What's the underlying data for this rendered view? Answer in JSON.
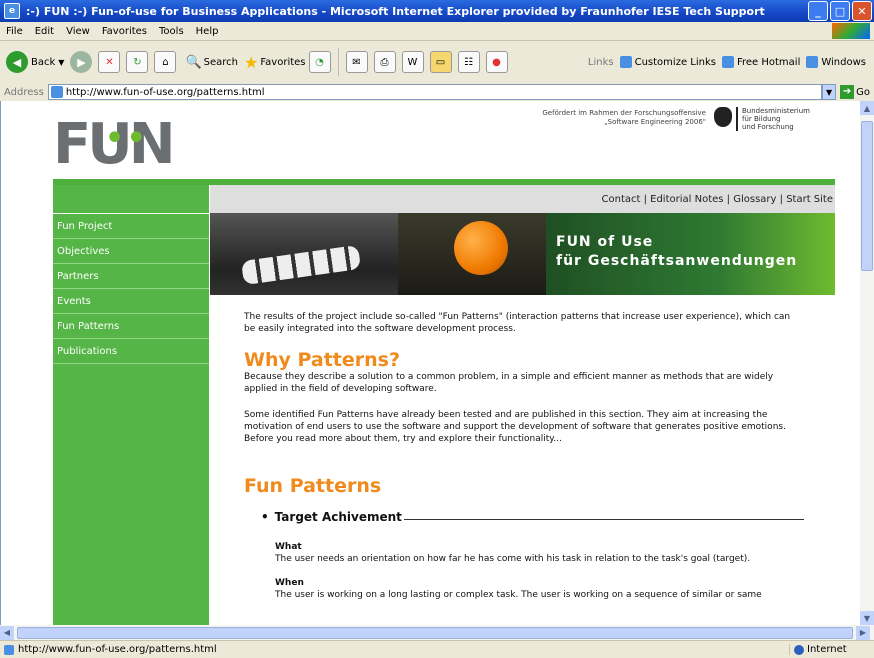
{
  "window": {
    "title": ":-) FUN :-) Fun-of-use for Business Applications - Microsoft Internet Explorer provided by Fraunhofer IESE Tech Support"
  },
  "menu": [
    "File",
    "Edit",
    "View",
    "Favorites",
    "Tools",
    "Help"
  ],
  "toolbar": {
    "back_label": "Back",
    "search_label": "Search",
    "favorites_label": "Favorites",
    "links_label": "Links",
    "links": [
      "Customize Links",
      "Free Hotmail",
      "Windows"
    ]
  },
  "address": {
    "label": "Address",
    "url": "http://www.fun-of-use.org/patterns.html",
    "go_label": "Go"
  },
  "page": {
    "logo_text": "FUN",
    "funding_line1": "Gefördert im Rahmen der Forschungsoffensive",
    "funding_line2": "„Software Engineering 2006\"",
    "ministry_line1": "Bundesministerium",
    "ministry_line2": "für Bildung",
    "ministry_line3": "und Forschung",
    "topnav": [
      "Contact",
      "Editorial Notes",
      "Glossary",
      "Start Site"
    ],
    "nav_separator": " | ",
    "sidebar": [
      "Fun Project",
      "Objectives",
      "Partners",
      "Events",
      "Fun Patterns",
      "Publications"
    ],
    "banner_line1": "FUN of Use",
    "banner_line2": "für Geschäftsanwendungen",
    "intro": "The results of the project include so-called \"Fun Patterns\" (interaction patterns that increase user experience), which can be easily integrated into the software development process.",
    "why_heading": "Why Patterns?",
    "why_text": "Because they describe a solution to a common problem, in a simple and efficient manner as methods that are widely applied in the field of developing software.",
    "identified_text": "Some identified Fun Patterns have already been tested and are published in this section. They aim at increasing the motivation of end users to use the software and support the development of software that generates positive emotions. Before you read more about them, try and explore their functionality...",
    "fun_heading": "Fun Patterns",
    "pattern_title": "Target Achivement",
    "what_label": "What",
    "what_text": "The user needs an orientation on how far he has come with his task in relation to the task's goal (target).",
    "when_label": "When",
    "when_text": "The user is working on a long lasting or complex task. The user is working on a sequence of similar or same"
  },
  "status": {
    "text": "http://www.fun-of-use.org/patterns.html",
    "zone": "Internet"
  },
  "colors": {
    "accent_green": "#56b547",
    "heading_orange": "#f08a1c",
    "titlebar_blue": "#1447c5"
  }
}
